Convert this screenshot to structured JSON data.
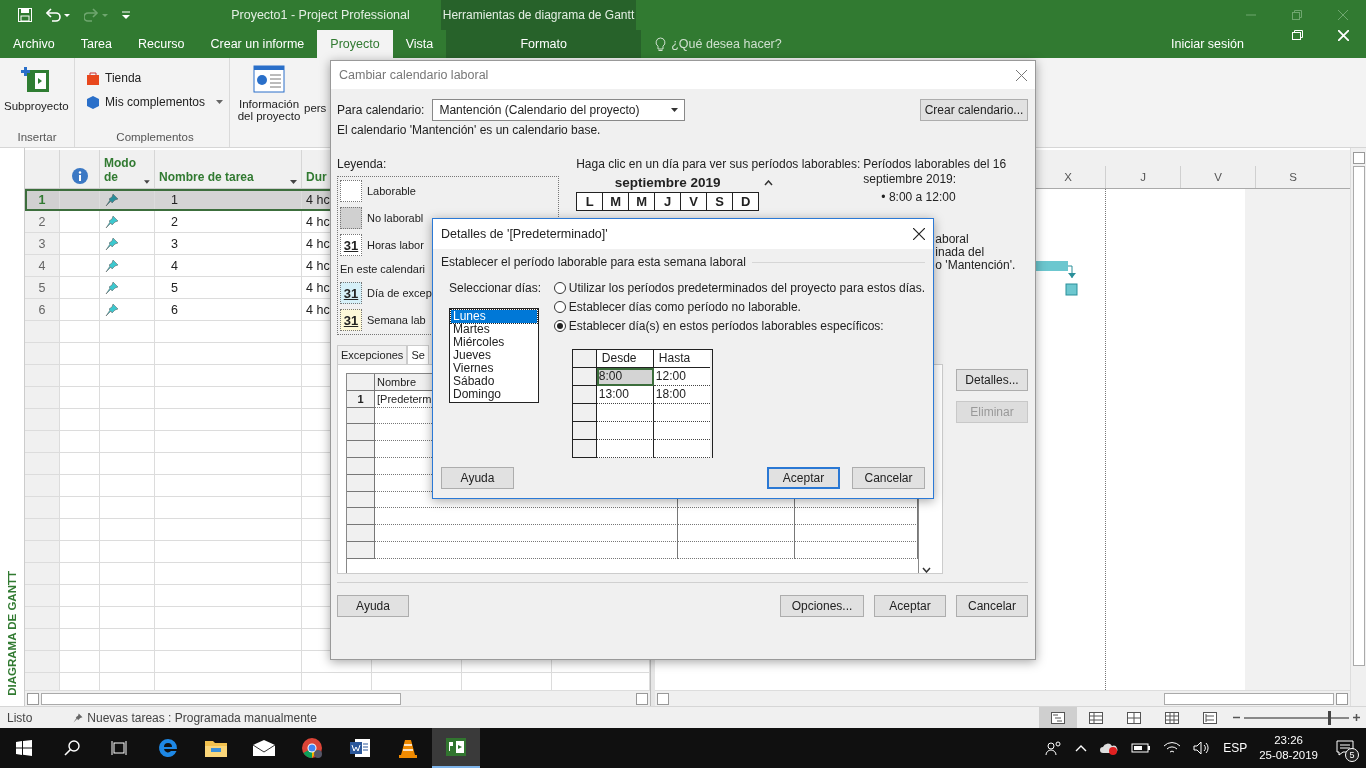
{
  "window": {
    "title": "Proyecto1 - Project Professional",
    "context_title": "Herramientas de diagrama de Gantt"
  },
  "ribbon_tabs": [
    {
      "label": "Archivo",
      "selected": false,
      "kind": "file"
    },
    {
      "label": "Tarea",
      "selected": false,
      "kind": "normal"
    },
    {
      "label": "Recurso",
      "selected": false,
      "kind": "normal"
    },
    {
      "label": "Crear un informe",
      "selected": false,
      "kind": "normal"
    },
    {
      "label": "Proyecto",
      "selected": true,
      "kind": "normal"
    },
    {
      "label": "Vista",
      "selected": false,
      "kind": "normal"
    },
    {
      "label": "Formato",
      "selected": false,
      "kind": "context"
    }
  ],
  "tell_me": {
    "placeholder": "¿Qué desea hacer?"
  },
  "account": {
    "sign_in": "Iniciar sesión"
  },
  "ribbon_groups": [
    {
      "label": "Insertar",
      "commands": [
        {
          "kind": "large",
          "label": "Subproyecto"
        }
      ]
    },
    {
      "label": "Complementos",
      "commands": [
        {
          "kind": "small",
          "label": "Tienda"
        },
        {
          "kind": "small-dropdown",
          "label": "Mis complementos"
        }
      ]
    },
    {
      "commands": [
        {
          "kind": "large",
          "label": "Información del proyecto"
        },
        {
          "kind": "cut",
          "label": "pers"
        }
      ]
    }
  ],
  "view_bar": {
    "label": "DIAGRAMA DE GANTT"
  },
  "task_table": {
    "columns": [
      {
        "label": "Modo de",
        "dropdown": true
      },
      {
        "label": "Nombre de tarea",
        "dropdown": true
      },
      {
        "label": "Dur",
        "dropdown": false
      }
    ],
    "rows": [
      {
        "id": "1",
        "name": "1",
        "duration": "4 hc",
        "selected": true
      },
      {
        "id": "2",
        "name": "2",
        "duration": "4 hc",
        "selected": false
      },
      {
        "id": "3",
        "name": "3",
        "duration": "4 hc",
        "selected": false
      },
      {
        "id": "4",
        "name": "4",
        "duration": "4 hc",
        "selected": false
      },
      {
        "id": "5",
        "name": "5",
        "duration": "4 hc",
        "selected": false
      },
      {
        "id": "6",
        "name": "6",
        "duration": "4 hc",
        "selected": false
      }
    ]
  },
  "timeline": {
    "days": [
      "X",
      "J",
      "V",
      "S"
    ]
  },
  "status_bar": {
    "mode": "Listo",
    "new_tasks": "Nuevas tareas : Programada manualmente",
    "zoom": {
      "level": 0.8
    }
  },
  "calendar_dialog": {
    "title": "Cambiar calendario laboral",
    "calendar_label": "Para calendario:",
    "calendar_value": "Mantención (Calendario del proyecto)",
    "create_button": "Crear calendario...",
    "info": "El calendario 'Mantención' es un calendario base.",
    "legend_title": "Leyenda:",
    "legend": [
      {
        "kind": "working",
        "label": "Laborable"
      },
      {
        "kind": "nonworking",
        "label": "No laborabl"
      },
      {
        "kind": "hours",
        "glyph": "31",
        "label": "Horas labor"
      },
      {
        "kind": "heading",
        "label": "En este calendari"
      },
      {
        "kind": "exception",
        "glyph": "31",
        "label": "Día de excep"
      },
      {
        "kind": "week",
        "glyph": "31",
        "label": "Semana lab"
      }
    ],
    "calendar_hint": "Haga clic en un día para ver sus períodos laborables:",
    "month": "septiembre 2019",
    "weekdays": [
      "L",
      "M",
      "M",
      "J",
      "V",
      "S",
      "D"
    ],
    "periods_title": "Períodos laborables del 16 septiembre 2019:",
    "periods": [
      "• 8:00 a 12:00"
    ],
    "note_fragments": [
      "aboral",
      "inada del",
      "o 'Mantención'."
    ],
    "tabs": [
      {
        "label": "Excepciones",
        "selected": false
      },
      {
        "label": "Se",
        "selected": true
      }
    ],
    "table": {
      "columns": [
        "Nombre"
      ],
      "rows": [
        {
          "id": "1",
          "name": "[Predeterm"
        }
      ]
    },
    "side_buttons": [
      {
        "label": "Detalles...",
        "disabled": false
      },
      {
        "label": "Eliminar",
        "disabled": true
      }
    ],
    "help_button": "Ayuda",
    "buttons": [
      "Opciones...",
      "Aceptar",
      "Cancelar"
    ]
  },
  "details_dialog": {
    "title": "Detalles de '[Predeterminado]'",
    "group_label": "Establecer el período laborable para esta semana laboral",
    "days_label": "Seleccionar días:",
    "days": [
      {
        "label": "Lunes",
        "selected": true
      },
      {
        "label": "Martes",
        "selected": false
      },
      {
        "label": "Miércoles",
        "selected": false
      },
      {
        "label": "Jueves",
        "selected": false
      },
      {
        "label": "Viernes",
        "selected": false
      },
      {
        "label": "Sábado",
        "selected": false
      },
      {
        "label": "Domingo",
        "selected": false
      }
    ],
    "options": [
      {
        "label": "Utilizar los períodos predeterminados del proyecto para estos días.",
        "selected": false
      },
      {
        "label": "Establecer días como período no laborable.",
        "selected": false
      },
      {
        "label": "Establecer día(s) en estos períodos laborables específicos:",
        "selected": true
      }
    ],
    "times": {
      "columns": [
        "Desde",
        "Hasta"
      ],
      "rows": [
        {
          "from": "8:00",
          "to": "12:00",
          "selected": true
        },
        {
          "from": "13:00",
          "to": "18:00",
          "selected": false
        }
      ]
    },
    "help_button": "Ayuda",
    "buttons": [
      {
        "label": "Aceptar",
        "default": true
      },
      {
        "label": "Cancelar",
        "default": false
      }
    ]
  },
  "taskbar": {
    "language": "ESP",
    "time": "23:26",
    "date": "25-08-2019",
    "notifications": "5"
  }
}
